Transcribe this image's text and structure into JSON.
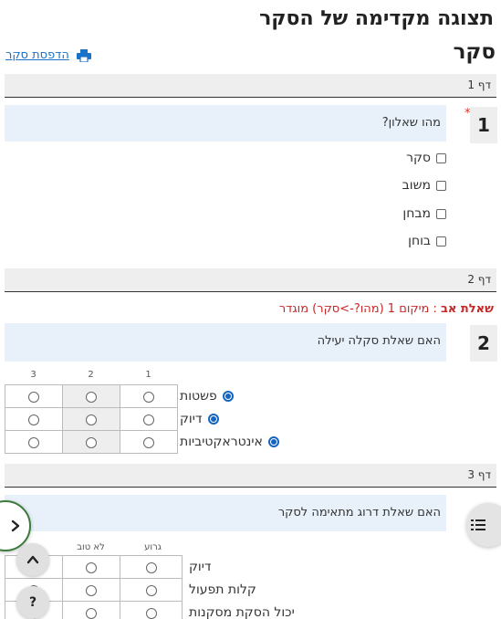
{
  "header": {
    "title": "תצוגה מקדימה של הסקר",
    "survey_name": "סקר",
    "print_label": "הדפסת סקר",
    "print_icon": "printer-icon"
  },
  "pages": [
    {
      "label": "דף 1"
    },
    {
      "label": "דף 2"
    },
    {
      "label": "דף 3"
    }
  ],
  "q1": {
    "number": "1",
    "required_mark": "*",
    "text": "מהו שאלון?",
    "options": [
      "סקר",
      "משוב",
      "מבחן",
      "בוחן"
    ]
  },
  "logic": {
    "label": "שאלת אב",
    "text": ": מיקום 1 (מהו?->סקר) מוגדר"
  },
  "q2": {
    "number": "2",
    "text": "האם שאלת סקלה יעילה",
    "columns": [
      "1",
      "2",
      "3"
    ],
    "rows": [
      "פשטות",
      "דיוק",
      "אינטראקטיביות"
    ]
  },
  "q3": {
    "text": "האם שאלת דרוג מתאימה לסקר",
    "columns": [
      "גרוע",
      "לא טוב"
    ],
    "rows": [
      "דיוק",
      "קלות תפעול",
      "יכול הסקת מסקנות"
    ]
  },
  "floating": {
    "next_icon": "chevron-right-icon",
    "up_icon": "chevron-up-icon",
    "help_label": "?",
    "menu_icon": "list-icon"
  },
  "colors": {
    "accent_blue": "#1565c0",
    "link_blue": "#1a73c7",
    "question_bg": "#e8f1fa",
    "required_red": "#d9302c",
    "next_border_green": "#3d7a3d"
  }
}
